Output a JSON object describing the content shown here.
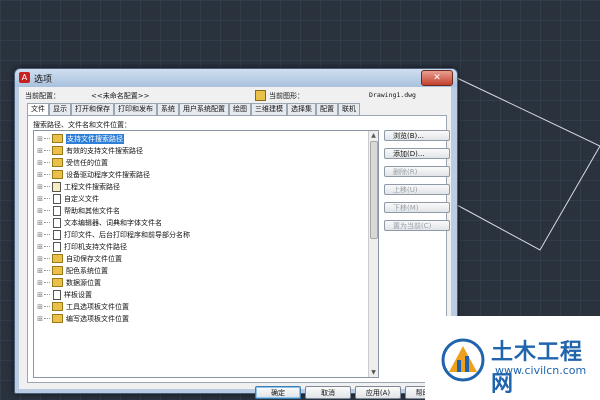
{
  "window": {
    "title": "选项",
    "close_glyph": "✕"
  },
  "profile": {
    "label": "当前配置：",
    "value": "<<未命名配置>>"
  },
  "drawing": {
    "label": "当前图形：",
    "value": "Drawing1.dwg"
  },
  "tabs": [
    {
      "label": "文件",
      "active": true
    },
    {
      "label": "显示"
    },
    {
      "label": "打开和保存"
    },
    {
      "label": "打印和发布"
    },
    {
      "label": "系统"
    },
    {
      "label": "用户系统配置"
    },
    {
      "label": "绘图"
    },
    {
      "label": "三维建模"
    },
    {
      "label": "选择集"
    },
    {
      "label": "配置"
    },
    {
      "label": "联机"
    }
  ],
  "tree": {
    "label": "搜索路径、文件名和文件位置：",
    "items": [
      {
        "label": "支持文件搜索路径",
        "icon": "folder-icon",
        "selected": true
      },
      {
        "label": "有效的支持文件搜索路径",
        "icon": "folder-icon"
      },
      {
        "label": "受信任的位置",
        "icon": "folder-icon"
      },
      {
        "label": "设备驱动程序文件搜索路径",
        "icon": "folder-icon"
      },
      {
        "label": "工程文件搜索路径",
        "icon": "grid-icon"
      },
      {
        "label": "自定义文件",
        "icon": "doc-icon"
      },
      {
        "label": "帮助和其他文件名",
        "icon": "doc-icon"
      },
      {
        "label": "文本编辑器、词典和字体文件名",
        "icon": "doc-icon"
      },
      {
        "label": "打印文件、后台打印程序和前导部分名称",
        "icon": "doc-icon"
      },
      {
        "label": "打印机支持文件路径",
        "icon": "doc-icon"
      },
      {
        "label": "自动保存文件位置",
        "icon": "folder-icon"
      },
      {
        "label": "配色系统位置",
        "icon": "folder-icon"
      },
      {
        "label": "数据源位置",
        "icon": "folder-icon"
      },
      {
        "label": "样板设置",
        "icon": "doc-icon"
      },
      {
        "label": "工具选项板文件位置",
        "icon": "folder-icon"
      },
      {
        "label": "编写选项板文件位置",
        "icon": "folder-icon"
      }
    ]
  },
  "side_buttons": [
    {
      "label": "浏览(B)...",
      "enabled": true
    },
    {
      "label": "添加(D)...",
      "enabled": true
    },
    {
      "label": "删除(R)",
      "enabled": false
    },
    {
      "label": "上移(U)",
      "enabled": false
    },
    {
      "label": "下移(M)",
      "enabled": false
    },
    {
      "label": "置为当前(C)",
      "enabled": false
    }
  ],
  "bottom_buttons": {
    "ok": "确定",
    "cancel": "取消",
    "apply": "应用(A)",
    "help": "帮助(H)"
  },
  "watermark": {
    "title": "土木工程网",
    "url": "www.civilcn.com"
  },
  "colors": {
    "accent": "#2f7fd8",
    "cad_background": "#2a323e",
    "watermark_blue": "#1f64ad"
  }
}
